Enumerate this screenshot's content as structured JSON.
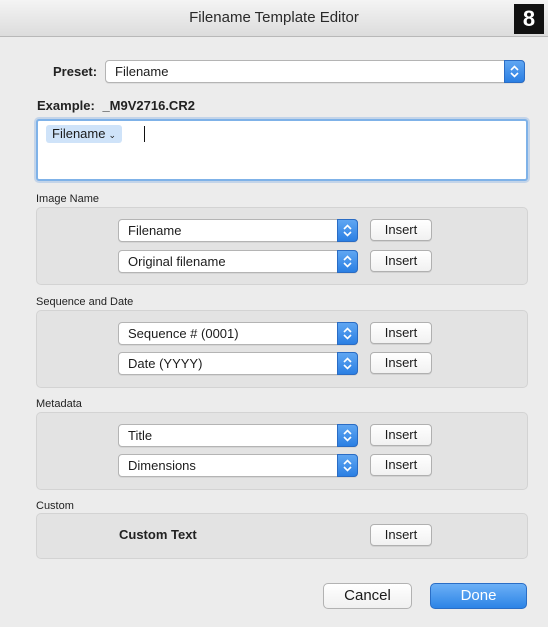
{
  "window": {
    "title": "Filename Template Editor",
    "badge": "8"
  },
  "preset": {
    "label": "Preset:",
    "value": "Filename"
  },
  "example": {
    "label": "Example:",
    "value": "_M9V2716.CR2"
  },
  "template": {
    "token": "Filename",
    "token_chevron": "⌄"
  },
  "sections": {
    "image_name": {
      "title": "Image Name",
      "rows": [
        {
          "value": "Filename",
          "button": "Insert"
        },
        {
          "value": "Original filename",
          "button": "Insert"
        }
      ]
    },
    "sequence_date": {
      "title": "Sequence and Date",
      "rows": [
        {
          "value": "Sequence # (0001)",
          "button": "Insert"
        },
        {
          "value": "Date (YYYY)",
          "button": "Insert"
        }
      ]
    },
    "metadata": {
      "title": "Metadata",
      "rows": [
        {
          "value": "Title",
          "button": "Insert"
        },
        {
          "value": "Dimensions",
          "button": "Insert"
        }
      ]
    },
    "custom": {
      "title": "Custom",
      "label": "Custom Text",
      "button": "Insert"
    }
  },
  "footer": {
    "cancel": "Cancel",
    "done": "Done"
  },
  "colors": {
    "accent": "#2c84e6",
    "token_bg": "#cfe3f9"
  }
}
